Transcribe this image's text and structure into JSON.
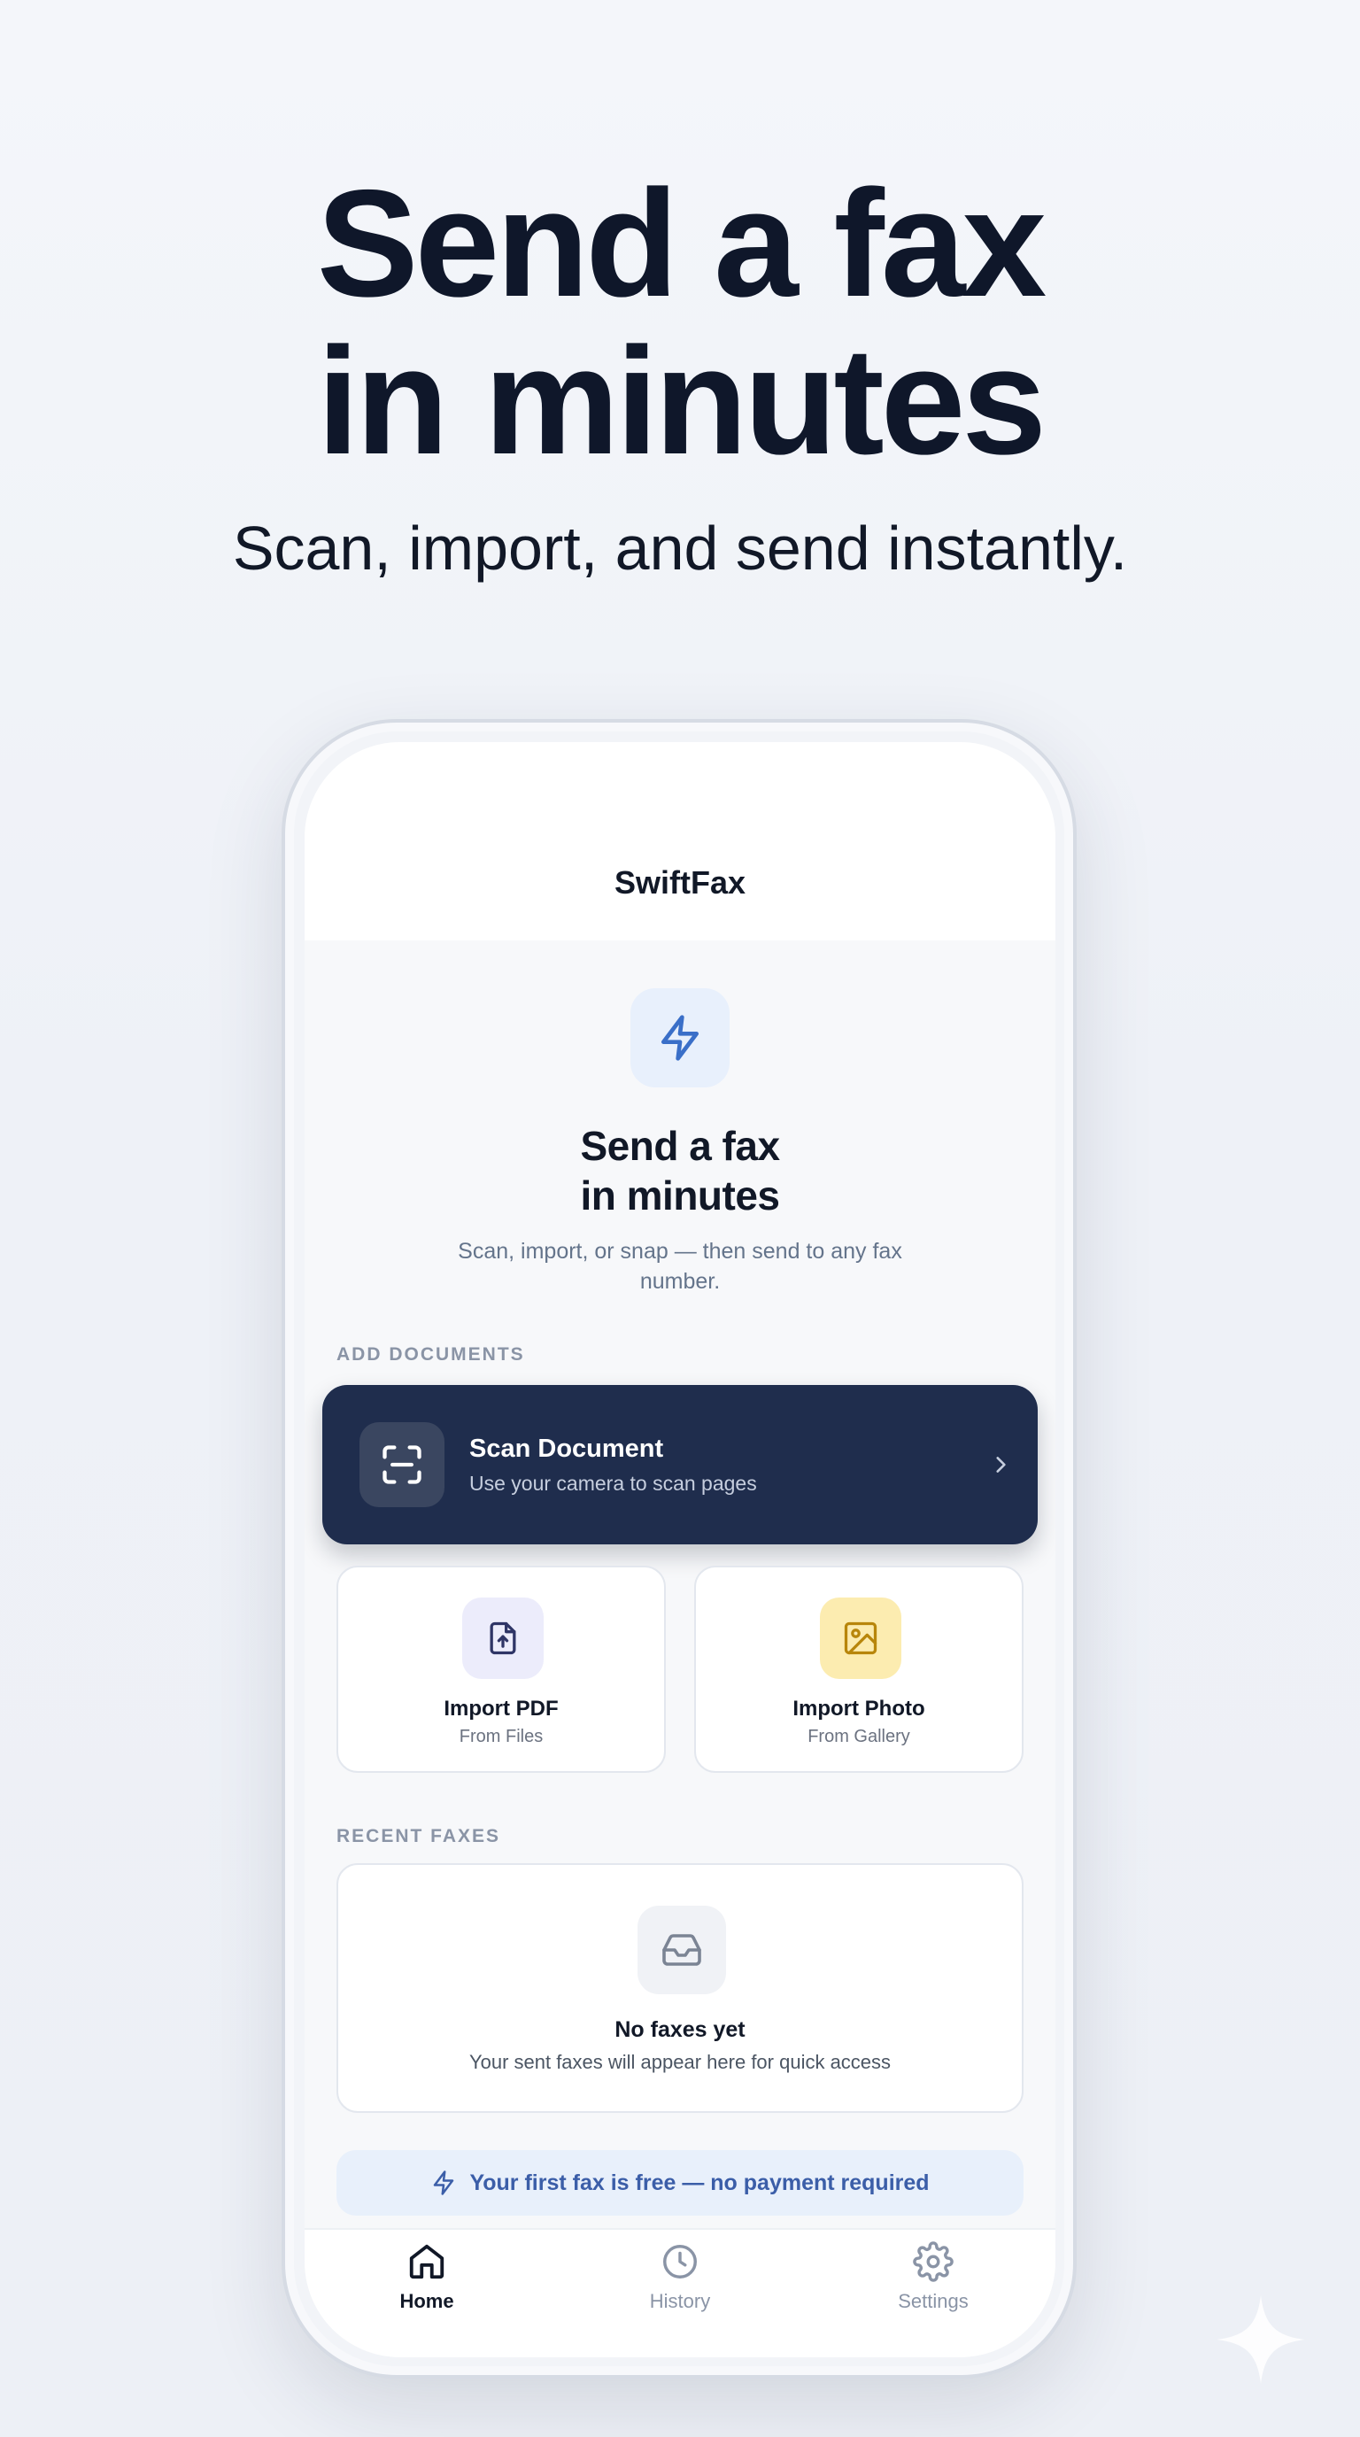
{
  "marketing": {
    "headline_line1": "Send a fax",
    "headline_line2": "in minutes",
    "subhead": "Scan, import, and send instantly."
  },
  "app": {
    "title": "SwiftFax",
    "hero_icon": "lightning-icon",
    "hero_title_line1": "Send a fax",
    "hero_title_line2": "in minutes",
    "hero_subtitle": "Scan, import, or snap — then send to any fax number."
  },
  "add_documents": {
    "section_label": "ADD DOCUMENTS",
    "scan": {
      "icon": "scan-frame-icon",
      "title": "Scan Document",
      "subtitle": "Use your camera to scan pages"
    },
    "import_pdf": {
      "icon": "file-upload-icon",
      "title": "Import PDF",
      "subtitle": "From Files"
    },
    "import_photo": {
      "icon": "image-icon",
      "title": "Import Photo",
      "subtitle": "From Gallery"
    }
  },
  "recent_faxes": {
    "section_label": "RECENT FAXES",
    "empty_icon": "inbox-icon",
    "empty_title": "No faxes yet",
    "empty_subtitle": "Your sent faxes will appear here for quick access"
  },
  "promo": {
    "icon": "lightning-icon",
    "text": "Your first fax is free — no payment required"
  },
  "tabs": [
    {
      "label": "Home",
      "icon": "home-icon",
      "active": true
    },
    {
      "label": "History",
      "icon": "clock-icon",
      "active": false
    },
    {
      "label": "Settings",
      "icon": "gear-icon",
      "active": false
    }
  ],
  "colors": {
    "primary_dark": "#1f2d4d",
    "accent_blue": "#3b5ea8",
    "pdf_icon_bg": "#ececfb",
    "photo_icon_bg": "#fcecb0",
    "photo_icon_stroke": "#b8860b",
    "text_dark": "#111827",
    "text_muted": "#6b7280"
  }
}
